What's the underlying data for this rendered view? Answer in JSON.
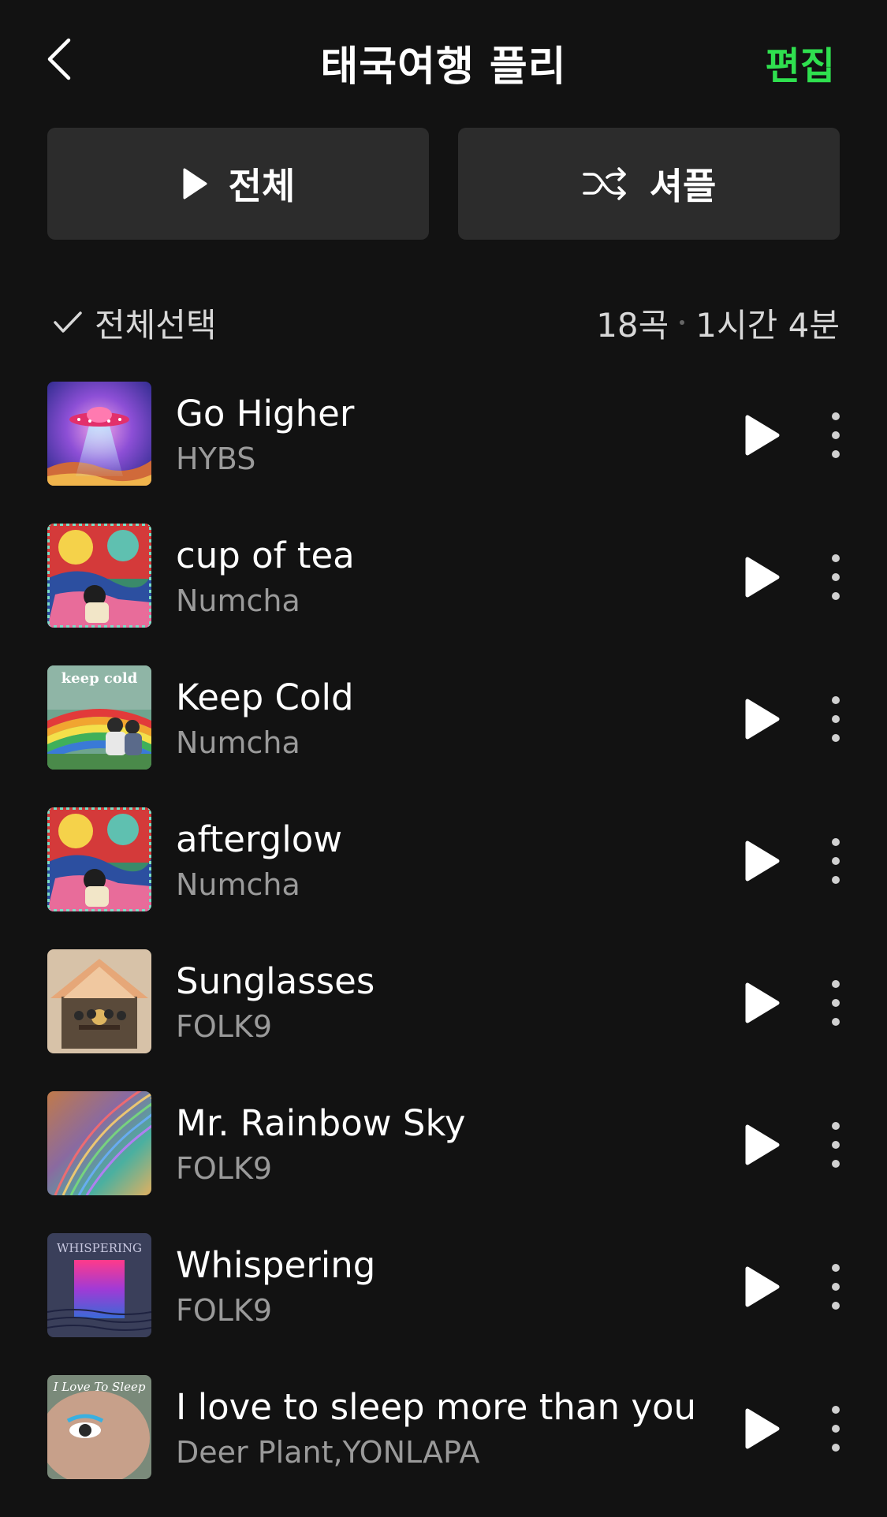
{
  "header": {
    "title": "태국여행 플리",
    "edit_label": "편집",
    "back_icon": "chevron-left-icon"
  },
  "actions": {
    "play_all_label": "전체",
    "shuffle_label": "셔플"
  },
  "summary": {
    "select_all_label": "전체선택",
    "track_count": "18곡",
    "duration": "1시간 4분"
  },
  "colors": {
    "background": "#121212",
    "accent": "#2fe04f",
    "button_bg": "#2c2c2c",
    "secondary_text": "#9a9a9a"
  },
  "tracks": [
    {
      "title": "Go Higher",
      "artist": "HYBS",
      "art": "ufo"
    },
    {
      "title": "cup of tea",
      "artist": "Numcha",
      "art": "numcha-collage"
    },
    {
      "title": "Keep Cold",
      "artist": "Numcha",
      "art": "keep-cold",
      "art_text": "keep cold"
    },
    {
      "title": "afterglow",
      "artist": "Numcha",
      "art": "numcha-collage"
    },
    {
      "title": "Sunglasses",
      "artist": "FOLK9",
      "art": "house"
    },
    {
      "title": "Mr. Rainbow Sky",
      "artist": "FOLK9",
      "art": "rainbow-waves"
    },
    {
      "title": "Whispering",
      "artist": "FOLK9",
      "art": "whispering",
      "art_text": "WHISPERING"
    },
    {
      "title": "I love to sleep more than you",
      "artist": "Deer Plant,YONLAPA",
      "art": "eye",
      "art_text": "I Love To Sleep"
    }
  ]
}
